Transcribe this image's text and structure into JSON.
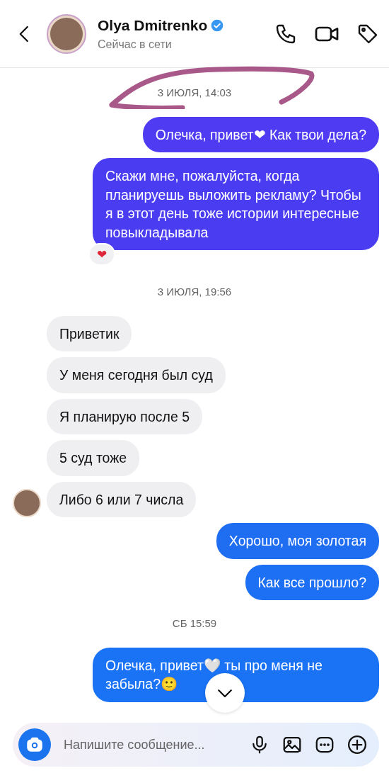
{
  "header": {
    "name": "Olya Dmitrenko",
    "verified": true,
    "status": "Сейчас в сети"
  },
  "items": [
    {
      "kind": "date",
      "text": "3 ИЮЛЯ, 14:03",
      "circled": true
    },
    {
      "kind": "message",
      "sent": true,
      "color": "#4f3cf2",
      "text": "Олечка, привет❤ Как твои дела?"
    },
    {
      "kind": "message",
      "sent": true,
      "color": "#4a3cf0",
      "text": "Скажи мне, пожалуйста, когда планируешь выложить рекламу? Чтобы я в этот день тоже истории интересные повыкладывала",
      "reaction": "❤"
    },
    {
      "kind": "date",
      "text": "3 ИЮЛЯ, 19:56",
      "circled": false
    },
    {
      "kind": "message",
      "sent": false,
      "color": "#efeff1",
      "text": "Приветик"
    },
    {
      "kind": "message",
      "sent": false,
      "color": "#efeff1",
      "text": "У меня сегодня был суд"
    },
    {
      "kind": "message",
      "sent": false,
      "color": "#efeff1",
      "text": "Я планирую после 5"
    },
    {
      "kind": "message",
      "sent": false,
      "color": "#efeff1",
      "text": "5 суд тоже"
    },
    {
      "kind": "message",
      "sent": false,
      "color": "#efeff1",
      "text": "Либо 6 или 7 числа",
      "avatar": true
    },
    {
      "kind": "message",
      "sent": true,
      "color": "#1f6ef2",
      "text": "Хорошо, моя золотая"
    },
    {
      "kind": "message",
      "sent": true,
      "color": "#1d6ff3",
      "text": "Как все прошло?"
    },
    {
      "kind": "date",
      "text": "СБ 15:59",
      "circled": false
    },
    {
      "kind": "message",
      "sent": true,
      "color": "#1a73f5",
      "text": "Олечка, привет🤍 ты про меня не забыла?🙂"
    }
  ],
  "composer": {
    "placeholder": "Напишите сообщение..."
  }
}
